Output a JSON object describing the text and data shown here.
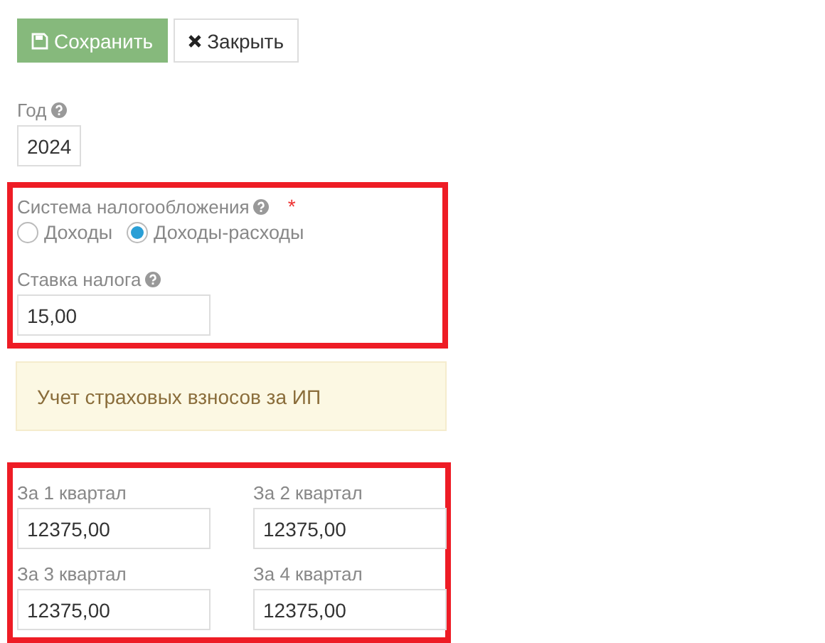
{
  "toolbar": {
    "buttons": [
      {
        "label": "Сохранить",
        "kind": "save"
      },
      {
        "label": "Закрыть",
        "kind": "close"
      }
    ]
  },
  "year": {
    "label": "Год",
    "value": "2024"
  },
  "tax_section": {
    "highlighted": true,
    "system": {
      "label": "Система налогообложения",
      "required_mark": "*",
      "options": [
        {
          "label": "Доходы",
          "selected": false
        },
        {
          "label": "Доходы-расходы",
          "selected": true
        }
      ]
    },
    "rate": {
      "label": "Ставка налога",
      "value": "15,00"
    }
  },
  "notice": "Учет страховых взносов за ИП",
  "quarters_section": {
    "highlighted": true,
    "fields": [
      {
        "label": "За 1 квартал",
        "value": "12375,00"
      },
      {
        "label": "За 2 квартал",
        "value": "12375,00"
      },
      {
        "label": "За 3 квартал",
        "value": "12375,00"
      },
      {
        "label": "За 4 квартал",
        "value": "12375,00"
      }
    ]
  }
}
